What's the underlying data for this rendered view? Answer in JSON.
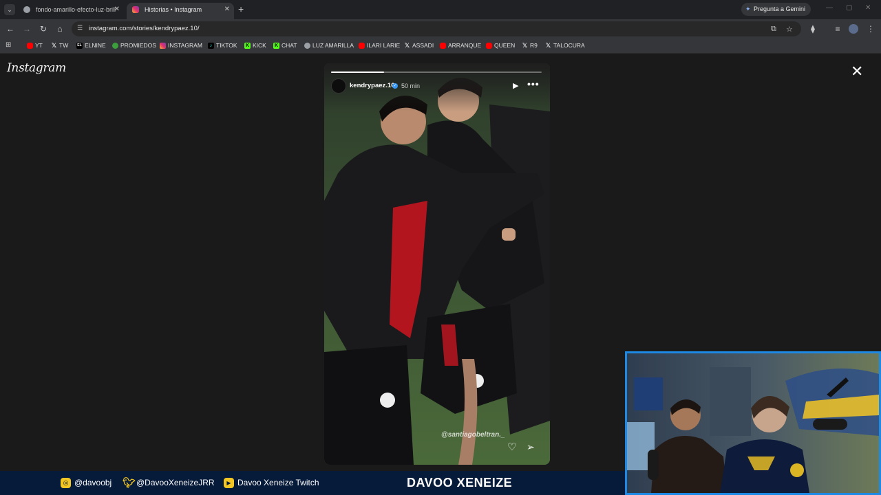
{
  "browser": {
    "tabs": [
      {
        "title": "fondo-amarillo-efecto-luz-brill",
        "active": false
      },
      {
        "title": "Historias • Instagram",
        "active": true
      }
    ],
    "gemini_label": "Pregunta a Gemini",
    "url": "instagram.com/stories/kendrypaez.10/"
  },
  "bookmarks": [
    {
      "label": "YT",
      "icon": "youtube-icon"
    },
    {
      "label": "TW",
      "icon": "x-icon"
    },
    {
      "label": "ELNINE",
      "icon": "elnine-icon"
    },
    {
      "label": "PROMIEDOS",
      "icon": "promiedos-icon"
    },
    {
      "label": "INSTAGRAM",
      "icon": "instagram-icon"
    },
    {
      "label": "TIKTOK",
      "icon": "tiktok-icon"
    },
    {
      "label": "KICK",
      "icon": "kick-icon"
    },
    {
      "label": "CHAT",
      "icon": "kick-icon"
    },
    {
      "label": "LUZ AMARILLA",
      "icon": "globe-icon"
    },
    {
      "label": "ILARI LARIE",
      "icon": "youtube-icon"
    },
    {
      "label": "ASSADI",
      "icon": "x-icon"
    },
    {
      "label": "ARRANQUE",
      "icon": "youtube-icon"
    },
    {
      "label": "QUEEN",
      "icon": "youtube-icon"
    },
    {
      "label": "R9",
      "icon": "x-icon"
    },
    {
      "label": "TALOCURA",
      "icon": "x-icon"
    }
  ],
  "instagram": {
    "logo": "Instagram",
    "story": {
      "username": "kendrypaez.10",
      "time": "50 min",
      "progress": 0.25,
      "photo_tag": "@santiagobeltran._"
    }
  },
  "stream_overlay": {
    "instagram": "@davoobj",
    "twitter": "@DavooXeneizeJRR",
    "twitch": "Davoo Xeneize Twitch",
    "brand": "DAVOO XENEIZE"
  },
  "colors": {
    "overlay_bg": "#061a3a",
    "overlay_accent": "#f3c623",
    "webcam_border": "#1e88e5"
  }
}
